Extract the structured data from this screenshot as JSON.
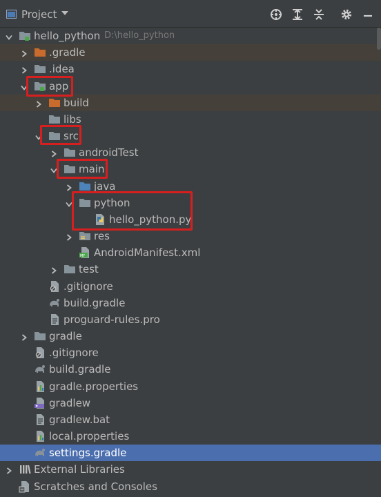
{
  "header": {
    "title": "Project"
  },
  "colors": {
    "selection": "#4b6eaf",
    "highlight": "#d81f1f",
    "background": "#3c3f41",
    "gradle_tint": "#45413a"
  },
  "tree": [
    {
      "label": "hello_python",
      "path": "D:\\hello_python",
      "icon": "module-folder-icon",
      "expanded": true
    },
    {
      "label": ".gradle",
      "icon": "excluded-folder-icon",
      "expanded": false
    },
    {
      "label": ".idea",
      "icon": "folder-icon",
      "expanded": false
    },
    {
      "label": "app",
      "icon": "module-folder-icon",
      "expanded": true
    },
    {
      "label": "build",
      "icon": "excluded-folder-icon",
      "expanded": false
    },
    {
      "label": "libs",
      "icon": "folder-icon"
    },
    {
      "label": "src",
      "icon": "folder-icon",
      "expanded": true
    },
    {
      "label": "androidTest",
      "icon": "folder-icon",
      "expanded": false
    },
    {
      "label": "main",
      "icon": "folder-icon",
      "expanded": true
    },
    {
      "label": "java",
      "icon": "source-folder-icon",
      "expanded": false
    },
    {
      "label": "python",
      "icon": "folder-icon",
      "expanded": true
    },
    {
      "label": "hello_python.py",
      "icon": "python-file-icon"
    },
    {
      "label": "res",
      "icon": "resource-folder-icon",
      "expanded": false
    },
    {
      "label": "AndroidManifest.xml",
      "icon": "manifest-file-icon"
    },
    {
      "label": "test",
      "icon": "folder-icon",
      "expanded": false
    },
    {
      "label": ".gitignore",
      "icon": "ignore-file-icon"
    },
    {
      "label": "build.gradle",
      "icon": "gradle-file-icon"
    },
    {
      "label": "proguard-rules.pro",
      "icon": "text-file-icon"
    },
    {
      "label": "gradle",
      "icon": "folder-icon",
      "expanded": false
    },
    {
      "label": ".gitignore",
      "icon": "ignore-file-icon"
    },
    {
      "label": "build.gradle",
      "icon": "gradle-file-icon"
    },
    {
      "label": "gradle.properties",
      "icon": "properties-file-icon"
    },
    {
      "label": "gradlew",
      "icon": "shell-file-icon"
    },
    {
      "label": "gradlew.bat",
      "icon": "text-file-icon"
    },
    {
      "label": "local.properties",
      "icon": "properties-file-icon"
    },
    {
      "label": "settings.gradle",
      "icon": "gradle-file-icon",
      "selected": true
    },
    {
      "label": "External Libraries",
      "icon": "libraries-icon",
      "expanded": false
    },
    {
      "label": "Scratches and Consoles",
      "icon": "scratches-icon"
    }
  ]
}
